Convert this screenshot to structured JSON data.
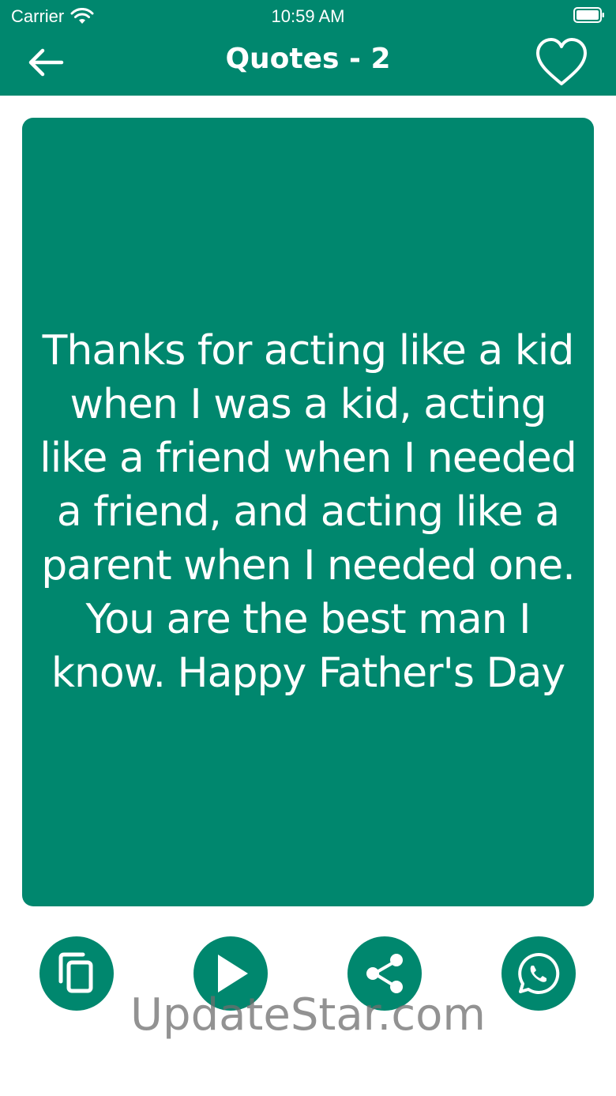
{
  "status_bar": {
    "carrier": "Carrier",
    "time": "10:59 AM"
  },
  "nav": {
    "title": "Quotes - 2",
    "back_icon": "arrow-left-icon",
    "favorite_icon": "heart-outline-icon"
  },
  "quote": {
    "text": "Thanks for acting like a kid when I was a kid, acting like a friend when I needed a friend, and acting like a parent when I needed one. You are the best man I know. Happy Father's Day"
  },
  "actions": [
    {
      "name": "copy",
      "icon": "copy-icon"
    },
    {
      "name": "play",
      "icon": "play-icon"
    },
    {
      "name": "share",
      "icon": "share-icon"
    },
    {
      "name": "whatsapp",
      "icon": "whatsapp-icon"
    }
  ],
  "watermark": "UpdateStar.com",
  "colors": {
    "primary": "#00876e",
    "on_primary": "#ffffff",
    "background": "#ffffff"
  }
}
